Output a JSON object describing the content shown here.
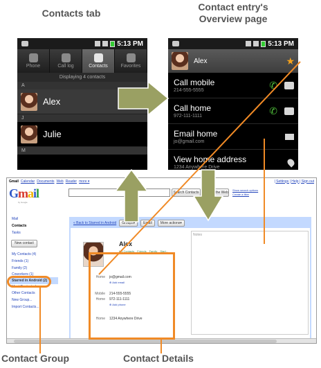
{
  "captions": {
    "contacts_tab": "Contacts tab",
    "overview_line1": "Contact entry's",
    "overview_line2": "Overview page",
    "contact_group": "Contact Group",
    "contact_details": "Contact Details"
  },
  "phone_left": {
    "time": "5:13 PM",
    "tabs": [
      "Phone",
      "Call log",
      "Contacts",
      "Favorites"
    ],
    "displaying": "Displaying 4 contacts",
    "sections": [
      "A",
      "J",
      "M"
    ],
    "contacts": [
      "Alex",
      "Julie"
    ]
  },
  "phone_right": {
    "time": "5:13 PM",
    "contact_name": "Alex",
    "rows": [
      {
        "main": "Call mobile",
        "sub": "214-555-5555"
      },
      {
        "main": "Call home",
        "sub": "972-111-1111"
      },
      {
        "main": "Email home",
        "sub": "jo@gmail.com"
      },
      {
        "main": "View home address",
        "sub": "1234 Anywhere Drive"
      }
    ]
  },
  "gmail": {
    "top_links": [
      "Gmail",
      "Calendar",
      "Documents",
      "Web",
      "Reader",
      "more ▾"
    ],
    "top_right": "| Settings | Help | Sign out",
    "logo_sub": "by Google",
    "search_contacts_btn": "Search Contacts",
    "search_web_btn": "Search the Web",
    "search_links": [
      "Show search options",
      "Create a filter"
    ],
    "nav": [
      "Mail",
      "Contacts",
      "Tasks"
    ],
    "new_contact": "New contact",
    "groups": [
      "My Contacts (4)",
      "Friends (1)",
      "Family (2)",
      "Coworkers (1)",
      "Starred in Android (2)",
      "Most Contacted"
    ],
    "other_links": [
      "Other Contacts",
      "New Group...",
      "Import Contacts..."
    ],
    "toolbar": {
      "back": "« Back to Starred in Android",
      "groups": "Groups▾",
      "email": "Email",
      "more": "More actions▾"
    },
    "notes_label": "Notes",
    "contact_name": "Alex",
    "tags": [
      "My Contacts",
      "Friends",
      "Family",
      "Start..."
    ],
    "details": [
      {
        "label": "Home",
        "value": "jo@gmail.com",
        "add": "Add email"
      },
      {
        "label": "Mobile",
        "value": "214-555-5555",
        "add": ""
      },
      {
        "label": "Home",
        "value": "972-111-1111",
        "add": "Add phone"
      },
      {
        "label": "Home",
        "value": "1234 Anywhere Drive",
        "add": ""
      }
    ]
  }
}
